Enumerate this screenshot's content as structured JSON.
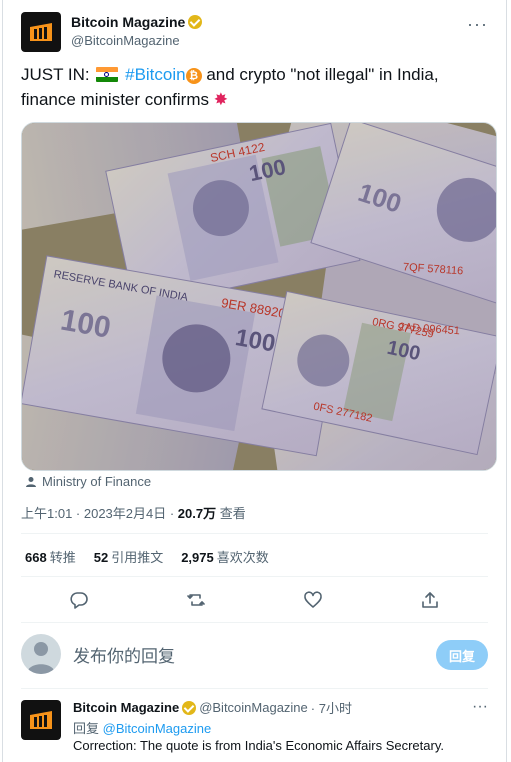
{
  "account": {
    "name": "Bitcoin Magazine",
    "handle": "@BitcoinMagazine"
  },
  "tweet": {
    "text_prefix": "JUST IN: ",
    "hashtag": "#Bitcoin",
    "text_suffix": " and crypto \"not illegal\" in India, finance minister confirms",
    "source_label": "Ministry of Finance",
    "timestamp": "上午1:01 · 2023年2月4日 · ",
    "views_count": "20.7万",
    "views_label": " 查看"
  },
  "stats": {
    "retweets_count": "668",
    "retweets_label": "转推",
    "quotes_count": "52",
    "quotes_label": "引用推文",
    "likes_count": "2,975",
    "likes_label": "喜欢次数"
  },
  "compose": {
    "placeholder": "发布你的回复",
    "reply_button": "回复"
  },
  "reply": {
    "name": "Bitcoin Magazine",
    "handle": "@BitcoinMagazine",
    "time": "· 7小时",
    "reply_to_prefix": "回复 ",
    "reply_to_handle": "@BitcoinMagazine",
    "text": "Correction: The quote is from India's Economic Affairs Secretary."
  },
  "icons": {
    "more": "more-icon",
    "reply": "reply-icon",
    "retweet": "retweet-icon",
    "like": "heart-icon",
    "share": "share-icon",
    "verified": "verified-badge-icon",
    "person": "person-icon"
  },
  "colors": {
    "accent": "#1d9bf0",
    "verified_gold": "#e2b719",
    "muted_text": "#536471",
    "reply_button_bg": "#8ecdf8"
  }
}
